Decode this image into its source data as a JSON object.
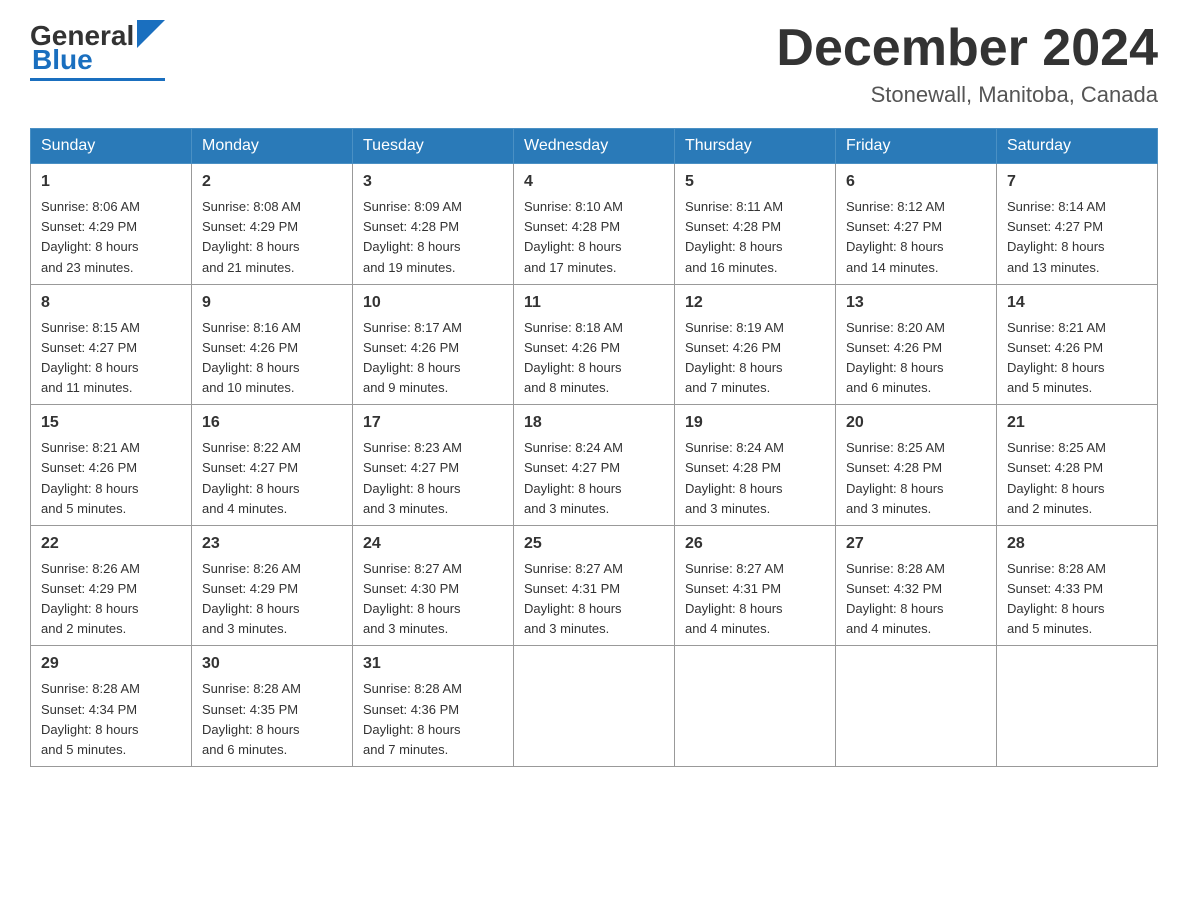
{
  "header": {
    "logo_general": "General",
    "logo_blue": "Blue",
    "month_title": "December 2024",
    "location": "Stonewall, Manitoba, Canada"
  },
  "weekdays": [
    "Sunday",
    "Monday",
    "Tuesday",
    "Wednesday",
    "Thursday",
    "Friday",
    "Saturday"
  ],
  "weeks": [
    [
      {
        "day": "1",
        "sunrise": "8:06 AM",
        "sunset": "4:29 PM",
        "daylight": "8 hours and 23 minutes."
      },
      {
        "day": "2",
        "sunrise": "8:08 AM",
        "sunset": "4:29 PM",
        "daylight": "8 hours and 21 minutes."
      },
      {
        "day": "3",
        "sunrise": "8:09 AM",
        "sunset": "4:28 PM",
        "daylight": "8 hours and 19 minutes."
      },
      {
        "day": "4",
        "sunrise": "8:10 AM",
        "sunset": "4:28 PM",
        "daylight": "8 hours and 17 minutes."
      },
      {
        "day": "5",
        "sunrise": "8:11 AM",
        "sunset": "4:28 PM",
        "daylight": "8 hours and 16 minutes."
      },
      {
        "day": "6",
        "sunrise": "8:12 AM",
        "sunset": "4:27 PM",
        "daylight": "8 hours and 14 minutes."
      },
      {
        "day": "7",
        "sunrise": "8:14 AM",
        "sunset": "4:27 PM",
        "daylight": "8 hours and 13 minutes."
      }
    ],
    [
      {
        "day": "8",
        "sunrise": "8:15 AM",
        "sunset": "4:27 PM",
        "daylight": "8 hours and 11 minutes."
      },
      {
        "day": "9",
        "sunrise": "8:16 AM",
        "sunset": "4:26 PM",
        "daylight": "8 hours and 10 minutes."
      },
      {
        "day": "10",
        "sunrise": "8:17 AM",
        "sunset": "4:26 PM",
        "daylight": "8 hours and 9 minutes."
      },
      {
        "day": "11",
        "sunrise": "8:18 AM",
        "sunset": "4:26 PM",
        "daylight": "8 hours and 8 minutes."
      },
      {
        "day": "12",
        "sunrise": "8:19 AM",
        "sunset": "4:26 PM",
        "daylight": "8 hours and 7 minutes."
      },
      {
        "day": "13",
        "sunrise": "8:20 AM",
        "sunset": "4:26 PM",
        "daylight": "8 hours and 6 minutes."
      },
      {
        "day": "14",
        "sunrise": "8:21 AM",
        "sunset": "4:26 PM",
        "daylight": "8 hours and 5 minutes."
      }
    ],
    [
      {
        "day": "15",
        "sunrise": "8:21 AM",
        "sunset": "4:26 PM",
        "daylight": "8 hours and 5 minutes."
      },
      {
        "day": "16",
        "sunrise": "8:22 AM",
        "sunset": "4:27 PM",
        "daylight": "8 hours and 4 minutes."
      },
      {
        "day": "17",
        "sunrise": "8:23 AM",
        "sunset": "4:27 PM",
        "daylight": "8 hours and 3 minutes."
      },
      {
        "day": "18",
        "sunrise": "8:24 AM",
        "sunset": "4:27 PM",
        "daylight": "8 hours and 3 minutes."
      },
      {
        "day": "19",
        "sunrise": "8:24 AM",
        "sunset": "4:28 PM",
        "daylight": "8 hours and 3 minutes."
      },
      {
        "day": "20",
        "sunrise": "8:25 AM",
        "sunset": "4:28 PM",
        "daylight": "8 hours and 3 minutes."
      },
      {
        "day": "21",
        "sunrise": "8:25 AM",
        "sunset": "4:28 PM",
        "daylight": "8 hours and 2 minutes."
      }
    ],
    [
      {
        "day": "22",
        "sunrise": "8:26 AM",
        "sunset": "4:29 PM",
        "daylight": "8 hours and 2 minutes."
      },
      {
        "day": "23",
        "sunrise": "8:26 AM",
        "sunset": "4:29 PM",
        "daylight": "8 hours and 3 minutes."
      },
      {
        "day": "24",
        "sunrise": "8:27 AM",
        "sunset": "4:30 PM",
        "daylight": "8 hours and 3 minutes."
      },
      {
        "day": "25",
        "sunrise": "8:27 AM",
        "sunset": "4:31 PM",
        "daylight": "8 hours and 3 minutes."
      },
      {
        "day": "26",
        "sunrise": "8:27 AM",
        "sunset": "4:31 PM",
        "daylight": "8 hours and 4 minutes."
      },
      {
        "day": "27",
        "sunrise": "8:28 AM",
        "sunset": "4:32 PM",
        "daylight": "8 hours and 4 minutes."
      },
      {
        "day": "28",
        "sunrise": "8:28 AM",
        "sunset": "4:33 PM",
        "daylight": "8 hours and 5 minutes."
      }
    ],
    [
      {
        "day": "29",
        "sunrise": "8:28 AM",
        "sunset": "4:34 PM",
        "daylight": "8 hours and 5 minutes."
      },
      {
        "day": "30",
        "sunrise": "8:28 AM",
        "sunset": "4:35 PM",
        "daylight": "8 hours and 6 minutes."
      },
      {
        "day": "31",
        "sunrise": "8:28 AM",
        "sunset": "4:36 PM",
        "daylight": "8 hours and 7 minutes."
      },
      null,
      null,
      null,
      null
    ]
  ]
}
